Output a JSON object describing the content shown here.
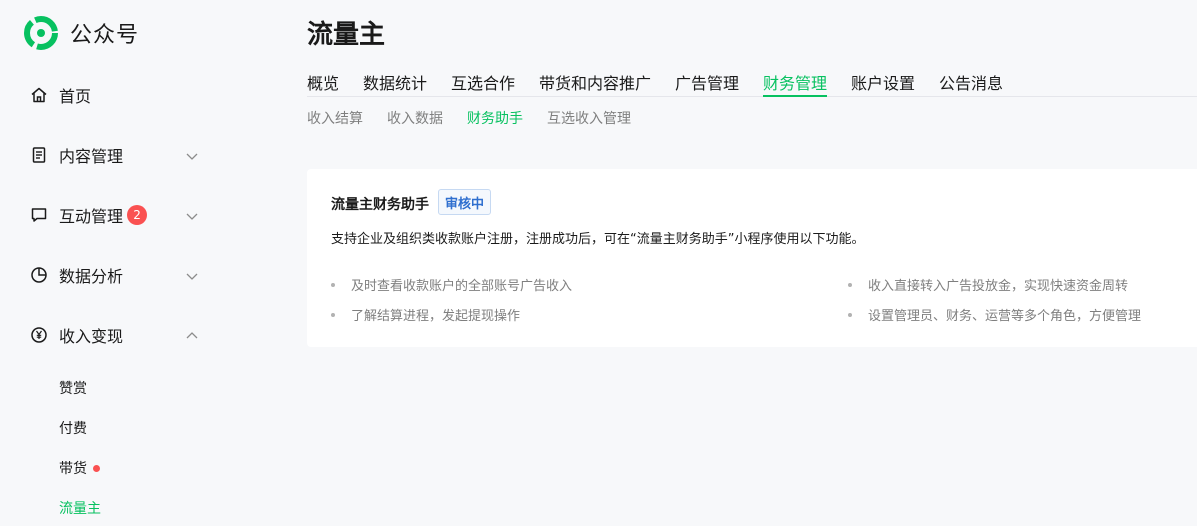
{
  "brand": {
    "name": "公众号",
    "icon": "wechat-official-account-logo",
    "color": "#07c160"
  },
  "sidebar": {
    "items": [
      {
        "label": "首页",
        "icon": "home-icon"
      },
      {
        "label": "内容管理",
        "icon": "document-icon",
        "expanded": false
      },
      {
        "label": "互动管理",
        "icon": "chat-bubble-icon",
        "badge": "2",
        "expanded": false
      },
      {
        "label": "数据分析",
        "icon": "pie-chart-icon",
        "expanded": false
      },
      {
        "label": "收入变现",
        "icon": "yuan-coin-icon",
        "expanded": true
      }
    ],
    "subitems": [
      {
        "label": "赞赏"
      },
      {
        "label": "付费"
      },
      {
        "label": "带货",
        "dot": true
      },
      {
        "label": "流量主",
        "active": true
      }
    ]
  },
  "main": {
    "title": "流量主",
    "tabs": [
      {
        "label": "概览"
      },
      {
        "label": "数据统计"
      },
      {
        "label": "互选合作"
      },
      {
        "label": "带货和内容推广"
      },
      {
        "label": "广告管理"
      },
      {
        "label": "财务管理",
        "active": true
      },
      {
        "label": "账户设置"
      },
      {
        "label": "公告消息"
      }
    ],
    "subtabs": [
      {
        "label": "收入结算"
      },
      {
        "label": "收入数据"
      },
      {
        "label": "财务助手",
        "active": true
      },
      {
        "label": "互选收入管理"
      }
    ],
    "card": {
      "title": "流量主财务助手",
      "status": "审核中",
      "description": "支持企业及组织类收款账户注册，注册成功后，可在“流量主财务助手”小程序使用以下功能。",
      "features": [
        "及时查看收款账户的全部账号广告收入",
        "了解结算进程，发起提现操作",
        "收入直接转入广告投放金，实现快速资金周转",
        "设置管理员、财务、运营等多个角色，方便管理"
      ]
    }
  },
  "colors": {
    "accent": "#07c160",
    "badge": "#fa5151",
    "status_tag": "#2f6fcf"
  }
}
